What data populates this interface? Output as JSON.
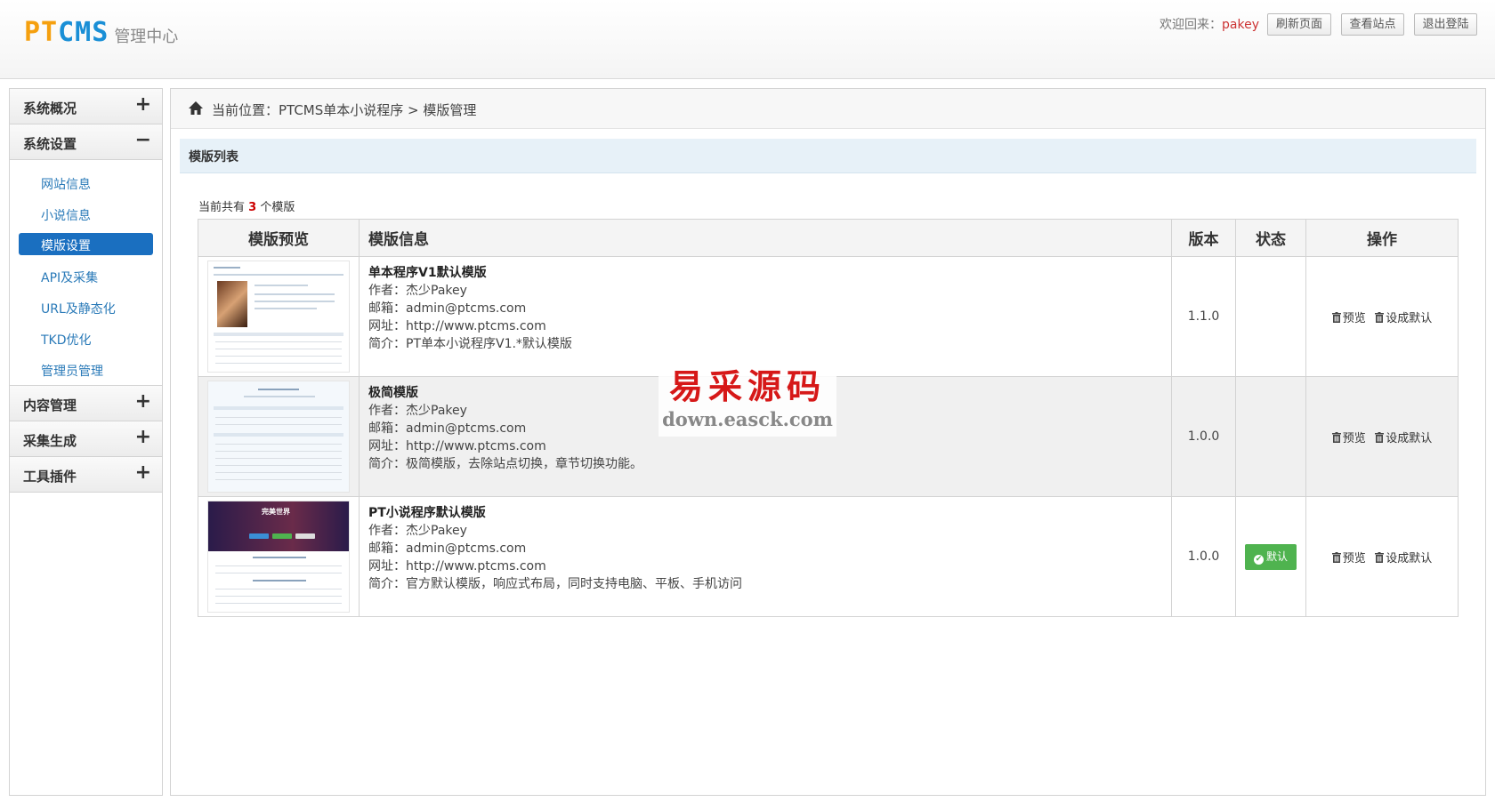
{
  "header": {
    "logo_pt": "PT",
    "logo_cms": "CMS",
    "logo_subtitle": "管理中心",
    "welcome_prefix": "欢迎回来：",
    "username": "pakey",
    "buttons": {
      "refresh": "刷新页面",
      "view_site": "查看站点",
      "logout": "退出登陆"
    }
  },
  "sidebar": {
    "groups": [
      {
        "label": "系统概况",
        "sign": "+"
      },
      {
        "label": "系统设置",
        "sign": "−"
      },
      {
        "label": "内容管理",
        "sign": "+"
      },
      {
        "label": "采集生成",
        "sign": "+"
      },
      {
        "label": "工具插件",
        "sign": "+"
      }
    ],
    "sub_items": [
      {
        "label": "网站信息"
      },
      {
        "label": "小说信息"
      },
      {
        "label": "模版设置",
        "active": true
      },
      {
        "label": "API及采集"
      },
      {
        "label": "URL及静态化"
      },
      {
        "label": "TKD优化"
      },
      {
        "label": "管理员管理"
      }
    ]
  },
  "breadcrumb": {
    "text": "当前位置：PTCMS单本小说程序 > 模版管理"
  },
  "panel": {
    "title": "模版列表",
    "count_prefix": "当前共有",
    "count": "3",
    "count_suffix": "个模版"
  },
  "table": {
    "headers": {
      "preview": "模版预览",
      "info": "模版信息",
      "version": "版本",
      "status": "状态",
      "actions": "操作"
    },
    "rows": [
      {
        "name": "单本程序V1默认模版",
        "author": "作者：杰少Pakey",
        "email": "邮箱：admin@ptcms.com",
        "url": "网址：http://www.ptcms.com",
        "desc": "简介：PT单本小说程序V1.*默认模版",
        "version": "1.1.0",
        "status": "",
        "preview_label": "预览",
        "default_label": "设成默认"
      },
      {
        "name": "极简模版",
        "author": "作者：杰少Pakey",
        "email": "邮箱：admin@ptcms.com",
        "url": "网址：http://www.ptcms.com",
        "desc": "简介：极简模版，去除站点切换，章节切换功能。",
        "version": "1.0.0",
        "status": "",
        "preview_label": "预览",
        "default_label": "设成默认"
      },
      {
        "name": "PT小说程序默认模版",
        "author": "作者：杰少Pakey",
        "email": "邮箱：admin@ptcms.com",
        "url": "网址：http://www.ptcms.com",
        "desc": "简介：官方默认模版，响应式布局，同时支持电脑、平板、手机访问",
        "version": "1.0.0",
        "status": "默认",
        "preview_label": "预览",
        "default_label": "设成默认"
      }
    ],
    "thumb3_title": "完美世界"
  },
  "watermark": {
    "cn": "易采源码",
    "url": "down.easck.com"
  },
  "colors": {
    "accent_blue": "#1a6fc0",
    "logo_orange": "#f5a00f",
    "logo_blue": "#1a8fd6",
    "default_green": "#4fb34f",
    "username_red": "#cc3333"
  }
}
